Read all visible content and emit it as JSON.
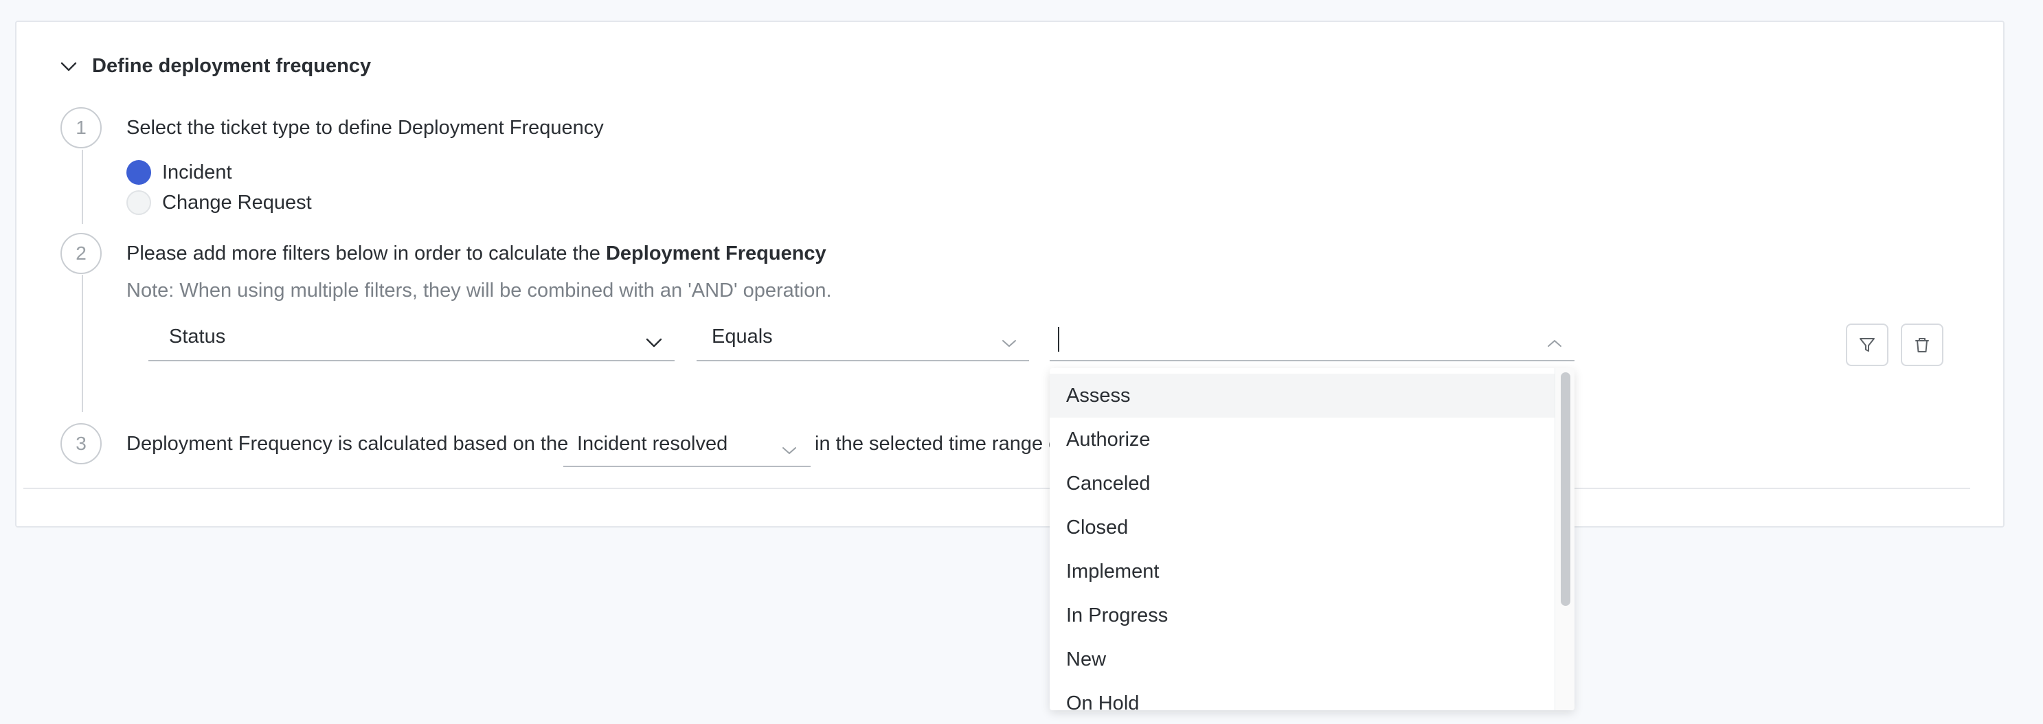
{
  "section": {
    "title": "Define deployment frequency",
    "collapse_icon": "chevron-down-icon"
  },
  "steps": [
    {
      "number": "1",
      "text": "Select the ticket type to define Deployment Frequency"
    },
    {
      "number": "2",
      "text_prefix": "Please add more filters below in order to calculate the ",
      "text_bold": "Deployment Frequency",
      "note": "Note: When using multiple filters, they will be combined with an 'AND' operation."
    },
    {
      "number": "3",
      "text_prefix": "Deployment Frequency is calculated based on the",
      "text_suffix": "in the selected time range c"
    }
  ],
  "ticket_types": [
    {
      "label": "Incident",
      "selected": true
    },
    {
      "label": "Change Request",
      "selected": false
    }
  ],
  "filter": {
    "field": {
      "value": "Status"
    },
    "operator": {
      "value": "Equals"
    },
    "value_input": {
      "value": ""
    },
    "filter_icon": "filter-icon",
    "delete_icon": "trash-icon"
  },
  "calculation": {
    "basis": {
      "value": "Incident resolved"
    }
  },
  "dropdown": {
    "options": [
      "Assess",
      "Authorize",
      "Canceled",
      "Closed",
      "Implement",
      "In Progress",
      "New",
      "On Hold"
    ],
    "highlighted_index": 0
  },
  "colors": {
    "accent": "#3d5fd4",
    "text": "#2a2e33",
    "muted": "#7b8188",
    "border": "#e4e7ec"
  }
}
